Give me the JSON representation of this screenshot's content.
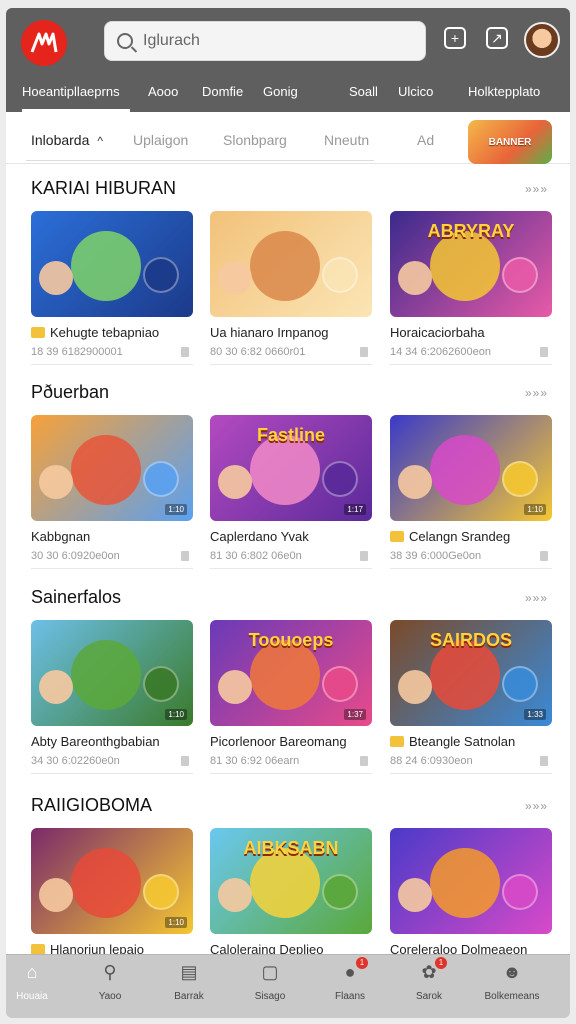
{
  "header": {
    "search_placeholder": "Iglurach",
    "nav": [
      "Hoeantipllaeprns",
      "Aooo",
      "Domfie",
      "Gonig",
      "Soall",
      "Ulcico",
      "Holktepplato"
    ]
  },
  "subtabs": [
    "Inlobarda",
    "Uplaigon",
    "Slonbparg",
    "Nneutn",
    "Ad"
  ],
  "promo_label": "BANNER",
  "sections": [
    {
      "title": "KARIAI HIBURAN",
      "more": "»»»",
      "cards": [
        {
          "title": "Kehugte tebapniao",
          "meta": "18 39 6182900001",
          "badge": "",
          "colors": [
            "#2b6fd8",
            "#7fd36a",
            "#1c3a8a"
          ],
          "has_tag": true
        },
        {
          "title": "Ua hianaro Irnpanog",
          "meta": "80 30 6:82 0660r01",
          "badge": "",
          "colors": [
            "#f2c27a",
            "#d9884a",
            "#fbe5b5"
          ],
          "has_tag": false
        },
        {
          "title": "Horaicaciorbaha",
          "meta": "14 34 6:2062600eon",
          "badge": "",
          "colors": [
            "#3a2a8c",
            "#f5c732",
            "#e85aa8"
          ],
          "has_tag": false,
          "banner": "ABRYRAY"
        }
      ]
    },
    {
      "title": "Pðuerban",
      "more": "»»»",
      "cards": [
        {
          "title": "Kabbgnan",
          "meta": "30 30 6:0920e0on",
          "badge": "1:10",
          "colors": [
            "#f7a13a",
            "#e8553a",
            "#5aa0f0"
          ],
          "has_tag": false
        },
        {
          "title": "Caplerdano Yvak",
          "meta": "81 30 6:802 06e0n",
          "badge": "1:17",
          "colors": [
            "#b44ac0",
            "#f28ac8",
            "#5a2a9a"
          ],
          "has_tag": false,
          "banner": "Fastline"
        },
        {
          "title": "Celangn Srandeg",
          "meta": "38 39 6:000Ge0on",
          "badge": "1:10",
          "colors": [
            "#3a3ac8",
            "#d84ac8",
            "#f5c732"
          ],
          "has_tag": true
        }
      ]
    },
    {
      "title": "Sainerfalos",
      "more": "»»»",
      "cards": [
        {
          "title": "Abty Bareonthgbabian",
          "meta": "34 30 6:02260e0n",
          "badge": "1:10",
          "colors": [
            "#6cc0e8",
            "#5aa83a",
            "#3a7a2a"
          ],
          "has_tag": false
        },
        {
          "title": "Picorlenoor Bareomang",
          "meta": "81 30 6:92 06earn",
          "badge": "1:37",
          "colors": [
            "#6a3ab8",
            "#f0783a",
            "#e84a8a"
          ],
          "has_tag": false,
          "banner": "Toouoeps"
        },
        {
          "title": "Bteangle Satnolan",
          "meta": "88 24 6:0930eon",
          "badge": "1:33",
          "colors": [
            "#7a4a2a",
            "#e84a3a",
            "#3a8ad8"
          ],
          "has_tag": true,
          "banner": "SAIRDOS"
        }
      ]
    },
    {
      "title": "RAIIGIOBOMA",
      "more": "»»»",
      "cards": [
        {
          "title": "Hlanoriun lepaio",
          "meta": "",
          "badge": "1:10",
          "colors": [
            "#7a2a6a",
            "#e84a3a",
            "#f5c732"
          ],
          "has_tag": true
        },
        {
          "title": "Caloleraing Deplieo",
          "meta": "",
          "badge": "",
          "colors": [
            "#6ac8f0",
            "#f7d23a",
            "#5aa83a"
          ],
          "has_tag": false,
          "banner": "AIBKSABN"
        },
        {
          "title": "Coreleraloo Dolmeaeon",
          "meta": "",
          "badge": "",
          "colors": [
            "#4a3ac8",
            "#f59a2a",
            "#d84ac8"
          ],
          "has_tag": false
        }
      ]
    }
  ],
  "tabbar": [
    {
      "label": "Houaia",
      "icon": "home-icon",
      "active": true,
      "dot": ""
    },
    {
      "label": "Yaoo",
      "icon": "search-icon",
      "active": false,
      "dot": ""
    },
    {
      "label": "Barrak",
      "icon": "news-icon",
      "active": false,
      "dot": ""
    },
    {
      "label": "Sisago",
      "icon": "bag-icon",
      "active": false,
      "dot": ""
    },
    {
      "label": "Flaans",
      "icon": "chat-icon",
      "active": false,
      "dot": "1"
    },
    {
      "label": "Sarok",
      "icon": "notification-icon",
      "active": false,
      "dot": "1"
    },
    {
      "label": "Bolkemeans",
      "icon": "profile-icon",
      "active": false,
      "dot": ""
    }
  ]
}
